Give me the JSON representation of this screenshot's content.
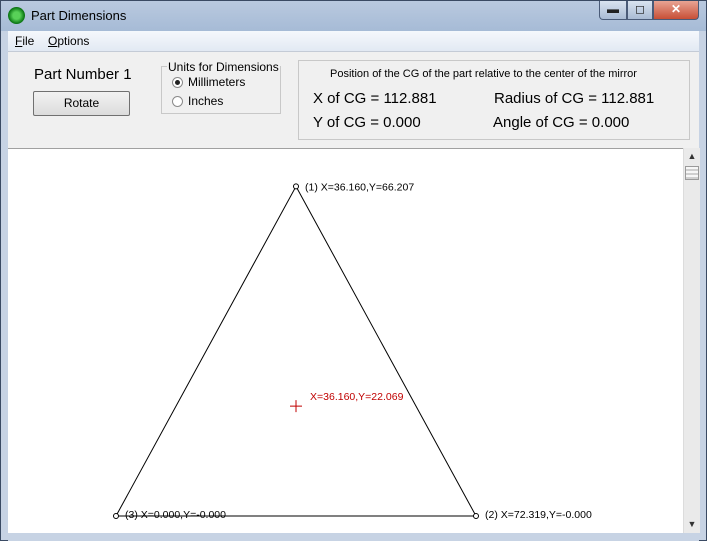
{
  "window": {
    "title": "Part Dimensions",
    "minimize": "▬",
    "maximize": "◻",
    "close": "✕"
  },
  "menu": {
    "file_key": "F",
    "file_rest": "ile",
    "options_key": "O",
    "options_rest": "ptions"
  },
  "part": {
    "number_label": "Part Number 1",
    "rotate_label": "Rotate"
  },
  "units": {
    "legend": "Units for Dimensions",
    "millimeters": "Millimeters",
    "inches": "Inches",
    "selected": "Millimeters"
  },
  "cg": {
    "heading": "Position of the CG of the part relative to the center of the mirror",
    "x_text": "X of CG = 112.881",
    "y_text": "Y of CG = 0.000",
    "radius_text": "Radius of CG = 112.881",
    "angle_text": "Angle of CG = 0.000"
  },
  "drawing": {
    "vertices": [
      {
        "label": "(1) X=36.160,Y=66.207",
        "x": 36.16,
        "y": 66.207
      },
      {
        "label": "(2) X=72.319,Y=-0.000",
        "x": 72.319,
        "y": -0.0
      },
      {
        "label": "(3) X=0.000,Y=-0.000",
        "x": 0.0,
        "y": -0.0
      }
    ],
    "centroid": {
      "label": "X=36.160,Y=22.069",
      "x": 36.16,
      "y": 22.069
    },
    "centroid_color": "#c00000"
  }
}
